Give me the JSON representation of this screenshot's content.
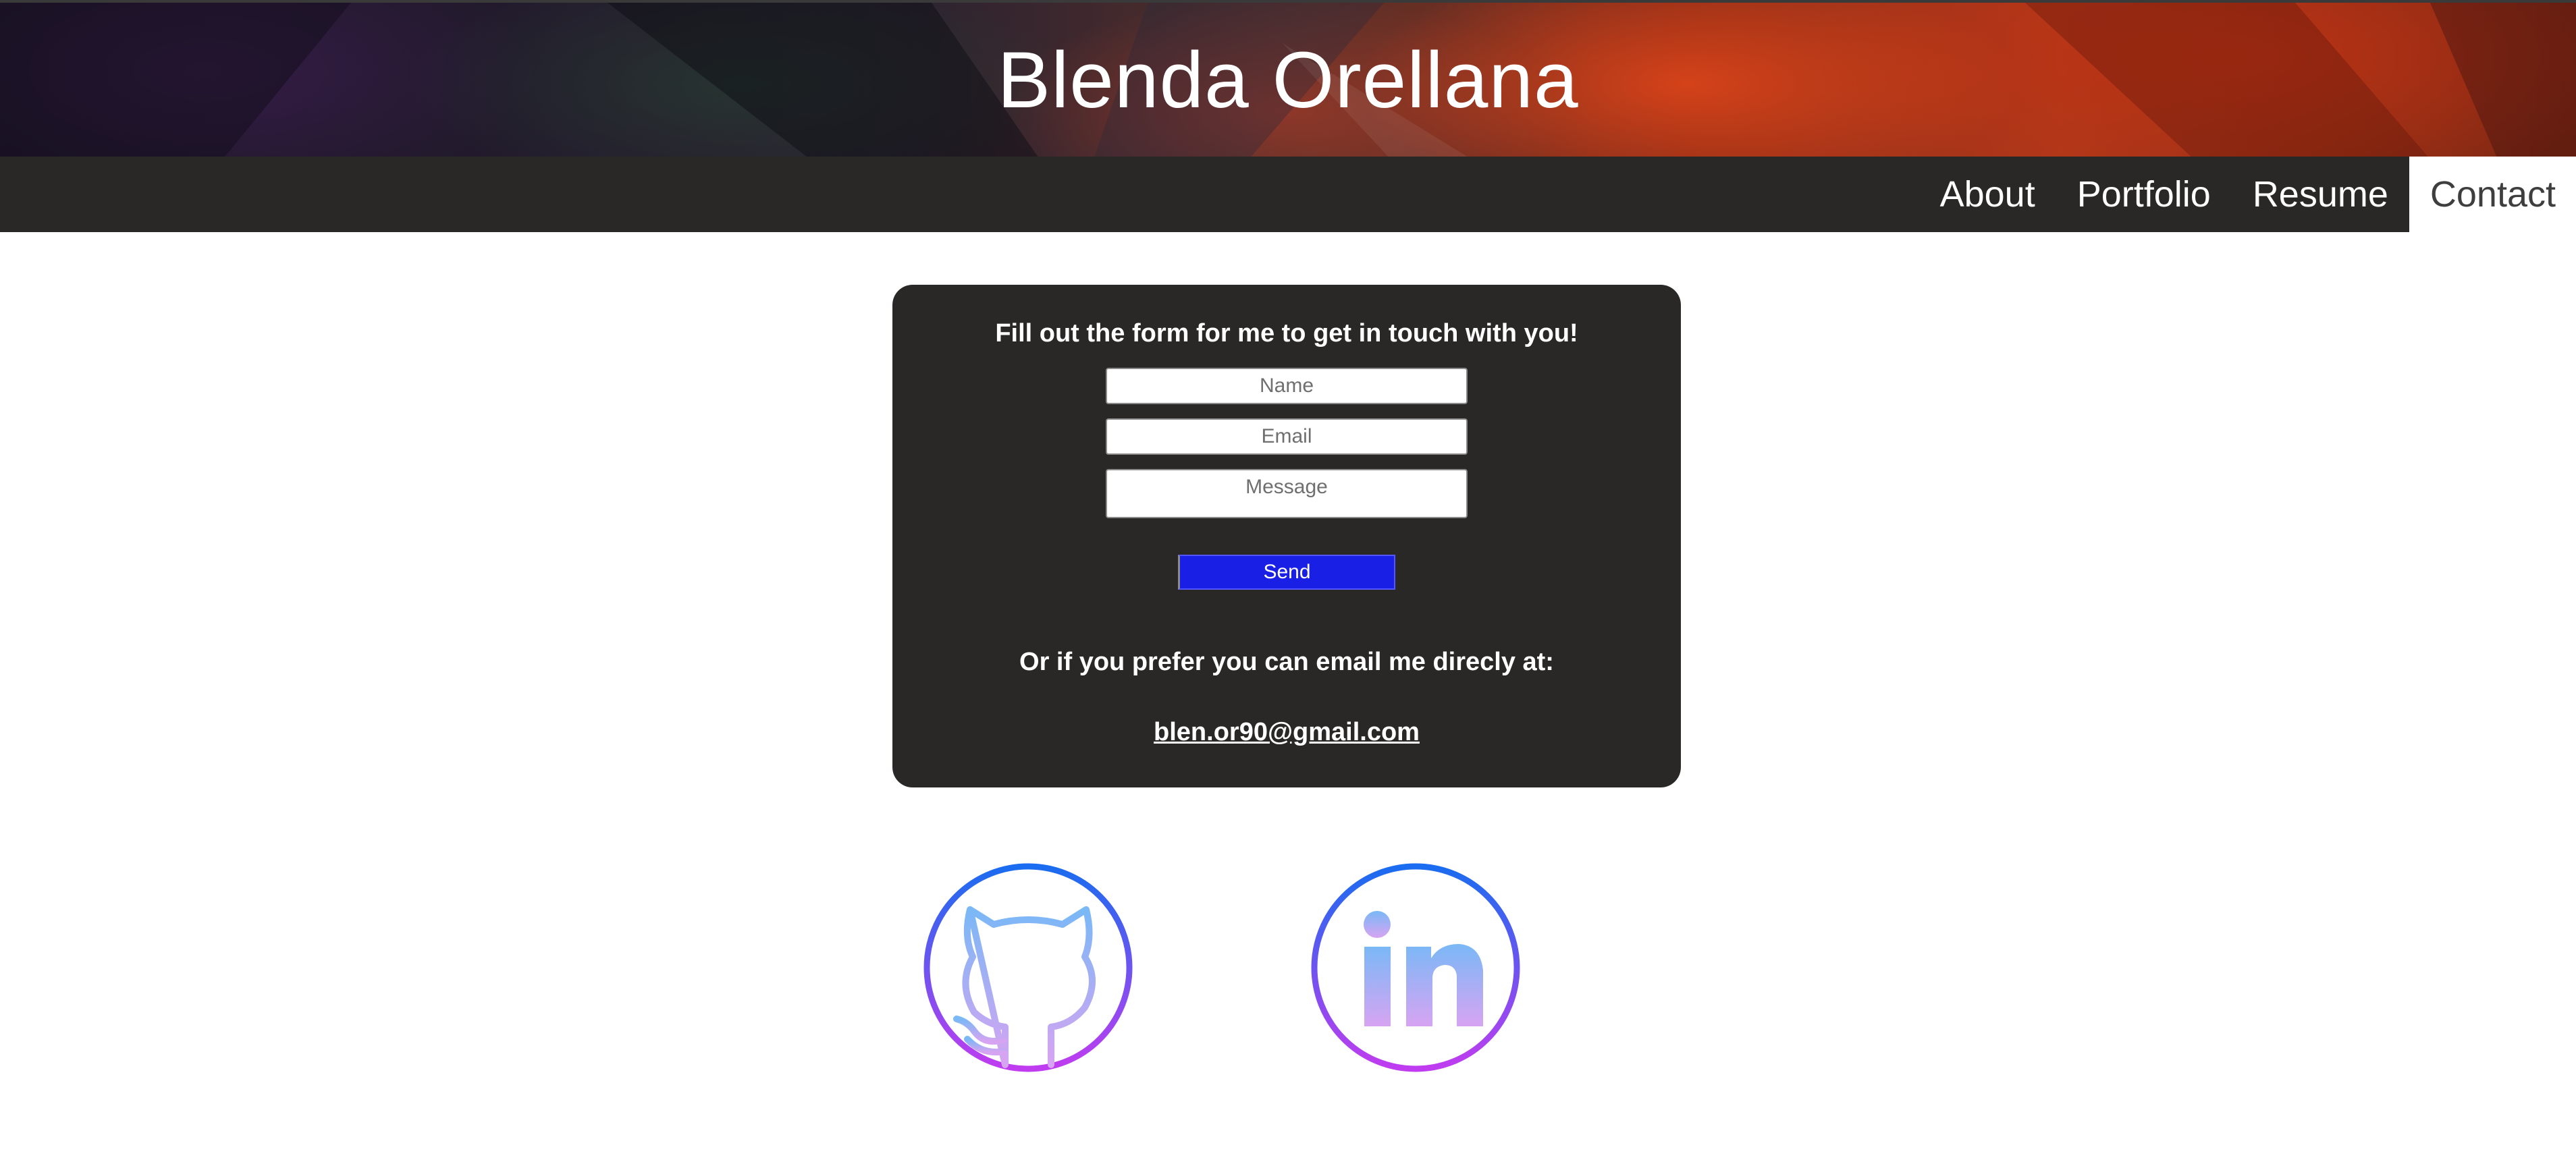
{
  "header": {
    "title": "Blenda Orellana"
  },
  "nav": {
    "items": [
      {
        "label": "About",
        "active": false
      },
      {
        "label": "Portfolio",
        "active": false
      },
      {
        "label": "Resume",
        "active": false
      },
      {
        "label": "Contact",
        "active": true
      }
    ]
  },
  "contact_form": {
    "heading": "Fill out the form for me to get in touch with you!",
    "name_placeholder": "Name",
    "email_placeholder": "Email",
    "message_placeholder": "Message",
    "send_label": "Send",
    "alt_text": "Or if you prefer you can email me direcly at:",
    "email_link": "blen.or90@gmail.com"
  },
  "social": {
    "github_icon": "github-icon",
    "linkedin_icon": "linkedin-icon"
  },
  "colors": {
    "nav_background": "#292827",
    "card_background": "#292827",
    "send_button": "#1a1fe6",
    "icon_gradient_top": "#1a6cf0",
    "icon_gradient_bottom": "#c03cf0"
  }
}
